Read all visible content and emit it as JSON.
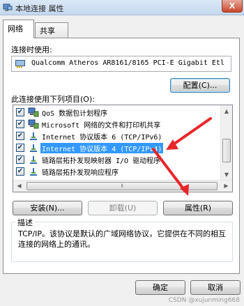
{
  "window": {
    "title": "本地连接 属性",
    "close_label": "X"
  },
  "tabs": [
    {
      "label": "网络",
      "active": true
    },
    {
      "label": "共享",
      "active": false
    }
  ],
  "connect_using": {
    "label": "连接时使用:",
    "adapter": "Qualcomm Atheros AR8161/8165 PCI-E Gigabit Etl",
    "configure_label": "配置(C)..."
  },
  "items_section": {
    "label": "此连接使用下列项目(O):",
    "items": [
      {
        "label": "QoS 数据包计划程序",
        "checked": true,
        "icon": "network-service-icon"
      },
      {
        "label": "Microsoft 网络的文件和打印机共享",
        "checked": true,
        "icon": "network-service-icon"
      },
      {
        "label": "Internet 协议版本 6 (TCP/IPv6)",
        "checked": true,
        "icon": "protocol-icon"
      },
      {
        "label": "Internet 协议版本 4 (TCP/IPv4)",
        "checked": true,
        "icon": "protocol-icon",
        "selected": true
      },
      {
        "label": "链路层拓扑发现映射器 I/O 驱动程序",
        "checked": true,
        "icon": "protocol-icon"
      },
      {
        "label": "链路层拓扑发现响应程序",
        "checked": true,
        "icon": "protocol-icon"
      }
    ],
    "check_mark": "✔"
  },
  "actions": {
    "install_label": "安装(N)...",
    "uninstall_label": "卸载(U)",
    "properties_label": "属性(R)"
  },
  "description": {
    "title": "描述",
    "text": "TCP/IP。该协议是默认的广域网络协议，它提供在不同的相互连接的网络上的通讯。"
  },
  "footer": {
    "ok_label": "确定",
    "cancel_label": "取消"
  },
  "watermark": "CSDN @xujunming668",
  "colors": {
    "selection": "#3399ff",
    "annotation_arrow": "#e8262a"
  }
}
